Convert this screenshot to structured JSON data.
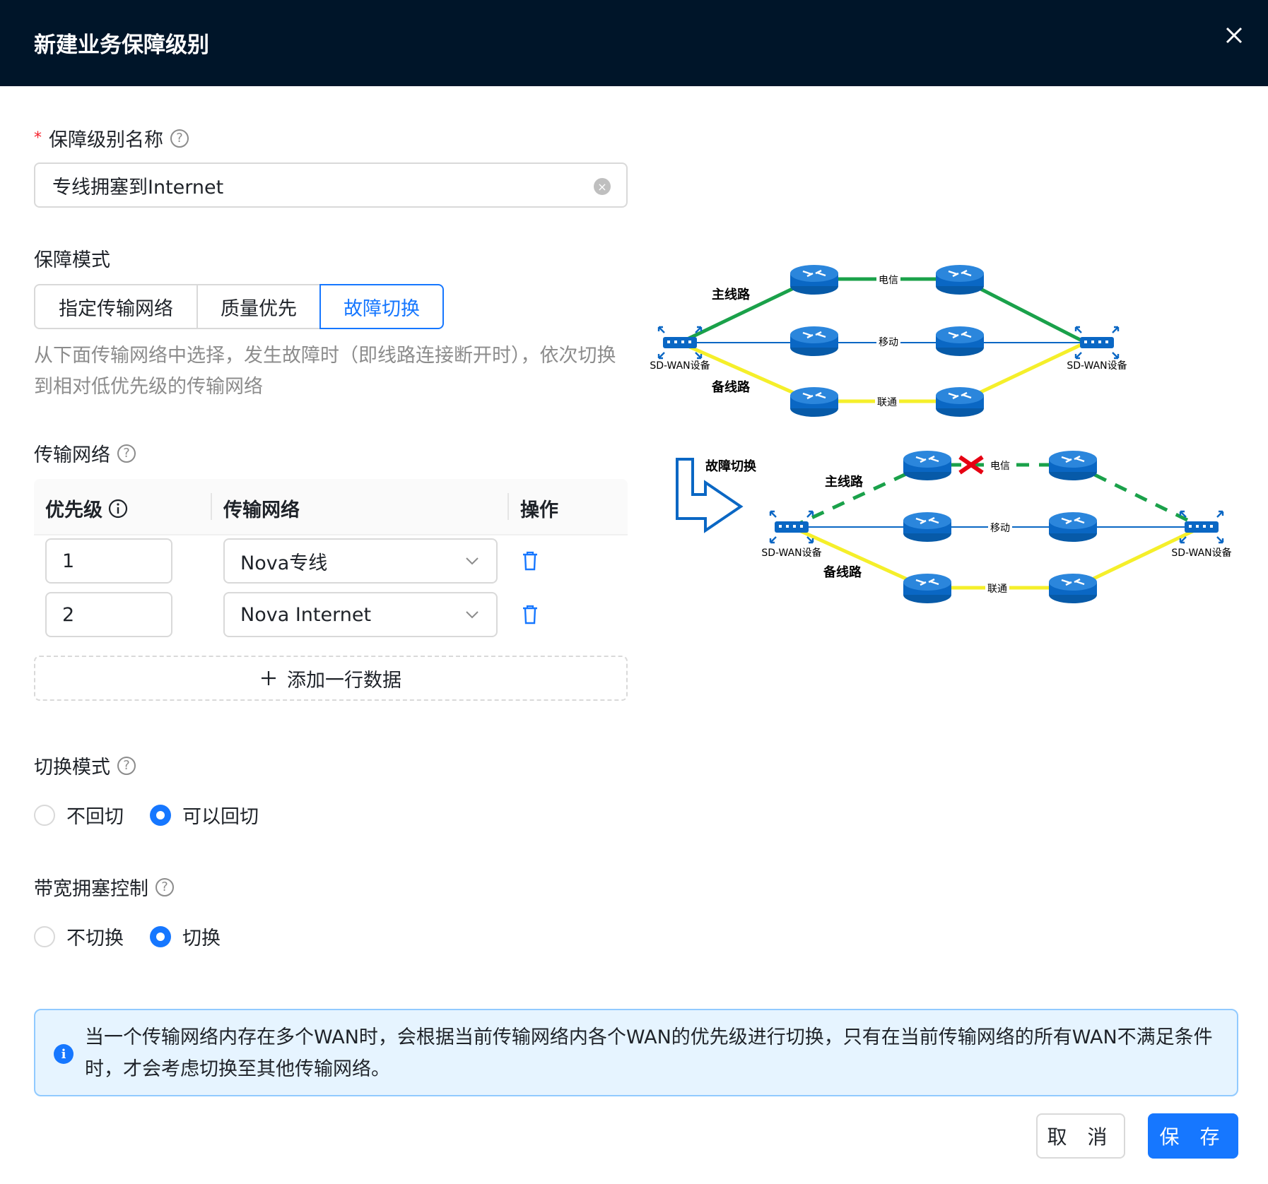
{
  "dialog": {
    "title": "新建业务保障级别",
    "close_icon": "close-icon"
  },
  "name_field": {
    "label": "保障级别名称",
    "required_mark": "*",
    "value": "专线拥塞到Internet"
  },
  "mode": {
    "label": "保障模式",
    "options": [
      "指定传输网络",
      "质量优先",
      "故障切换"
    ],
    "selected": "故障切换",
    "description": "从下面传输网络中选择，发生故障时（即线路连接断开时），依次切换到相对低优先级的传输网络"
  },
  "network": {
    "label": "传输网络",
    "columns": {
      "priority": "优先级",
      "network": "传输网络",
      "action": "操作"
    },
    "rows": [
      {
        "priority": "1",
        "network": "Nova专线"
      },
      {
        "priority": "2",
        "network": "Nova Internet"
      }
    ],
    "add_row": "添加一行数据"
  },
  "switch_mode": {
    "label": "切换模式",
    "options": [
      "不回切",
      "可以回切"
    ],
    "selected": "可以回切"
  },
  "congestion": {
    "label": "带宽拥塞控制",
    "options": [
      "不切换",
      "切换"
    ],
    "selected": "切换"
  },
  "alert": {
    "text": "当一个传输网络内存在多个WAN时，会根据当前传输网络内各个WAN的优先级进行切换，只有在当前传输网络的所有WAN不满足条件时，才会考虑切换至其他传输网络。"
  },
  "buttons": {
    "cancel": "取 消",
    "save": "保 存"
  },
  "diagram": {
    "main_line": "主线路",
    "backup_line": "备线路",
    "device": "SD-WAN设备",
    "isp1": "电信",
    "isp2": "移动",
    "isp3": "联通",
    "failover": "故障切换"
  },
  "colors": {
    "primary": "#1677ff",
    "header": "#001529",
    "main_line": "#1aa14a",
    "backup_line": "#f5ef2a",
    "router": "#0a67c4"
  }
}
